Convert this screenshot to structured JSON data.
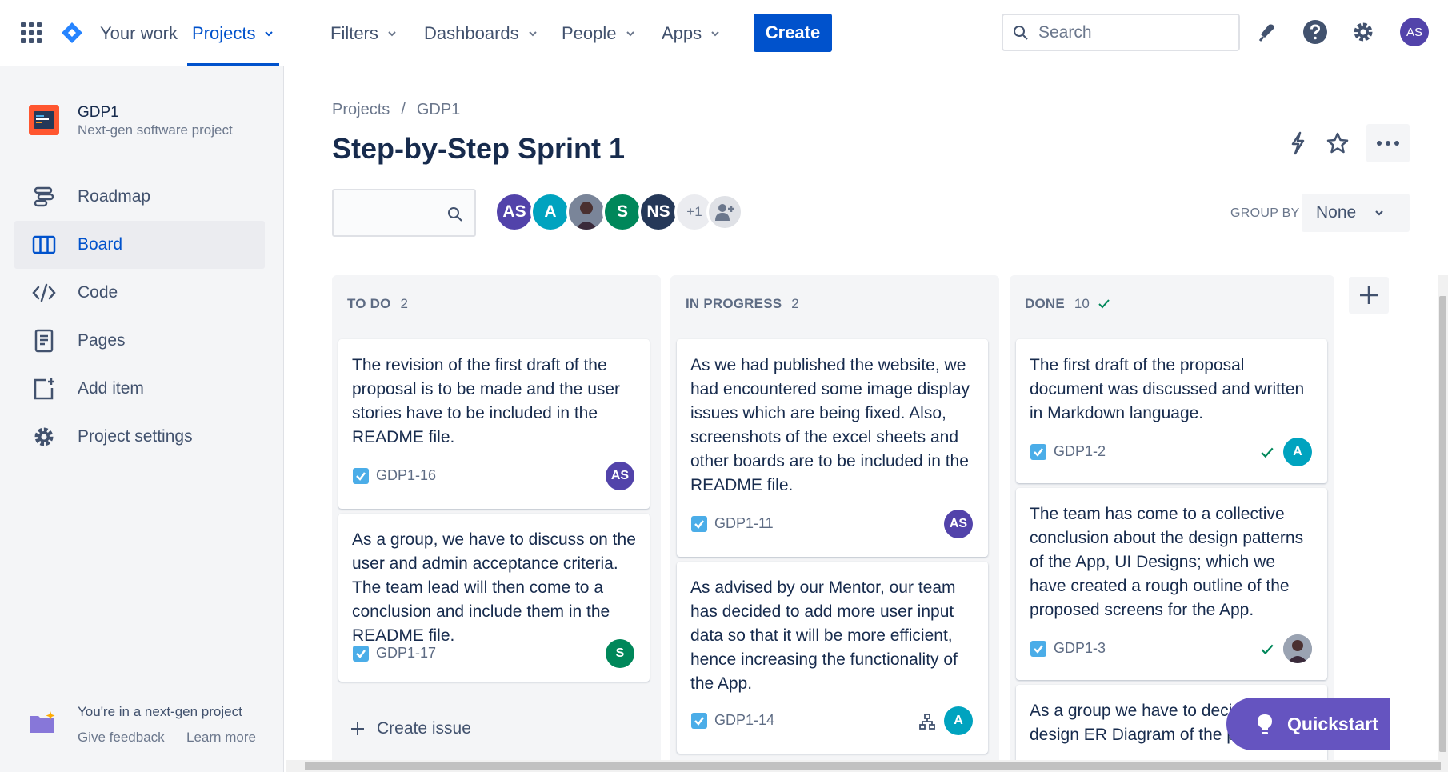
{
  "topnav": {
    "items": [
      {
        "label": "Your work"
      },
      {
        "label": "Projects"
      },
      {
        "label": "Filters"
      },
      {
        "label": "Dashboards"
      },
      {
        "label": "People"
      },
      {
        "label": "Apps"
      }
    ],
    "create_label": "Create",
    "search_placeholder": "Search",
    "user_initials": "AS",
    "accent": "#0052cc"
  },
  "sidebar": {
    "project_name": "GDP1",
    "project_type": "Next-gen software project",
    "items": [
      {
        "label": "Roadmap",
        "icon": "roadmap-icon"
      },
      {
        "label": "Board",
        "icon": "board-icon"
      },
      {
        "label": "Code",
        "icon": "code-icon"
      },
      {
        "label": "Pages",
        "icon": "pages-icon"
      },
      {
        "label": "Add item",
        "icon": "add-item-icon"
      },
      {
        "label": "Project settings",
        "icon": "gear-icon"
      }
    ],
    "footer_text": "You're in a next-gen project",
    "give_feedback": "Give feedback",
    "learn_more": "Learn more"
  },
  "header": {
    "breadcrumb": [
      "Projects",
      "GDP1"
    ],
    "breadcrumb_sep": "/",
    "title": "Step-by-Step Sprint 1",
    "members": [
      {
        "initials": "AS",
        "color": "#5243aa"
      },
      {
        "initials": "A",
        "color": "#00a3bf"
      },
      {
        "initials": "",
        "color": "#8993a4"
      },
      {
        "initials": "S",
        "color": "#00875a"
      },
      {
        "initials": "NS",
        "color": "#253858"
      }
    ],
    "extra_members": "+1",
    "group_by_label": "GROUP BY",
    "group_by_value": "None"
  },
  "columns": [
    {
      "name": "TO DO",
      "count": "2",
      "cards": [
        {
          "summary": "The revision of the first draft of the proposal is to be made and the user stories have to be included in the README file.",
          "key": "GDP1-16",
          "assignee": "AS",
          "color": "#5243aa"
        },
        {
          "summary": "As a group, we have to discuss on the user and admin acceptance criteria. The team lead will then come to a conclusion and include them in the README file.",
          "key": "GDP1-17",
          "assignee": "S",
          "color": "#00875a"
        }
      ],
      "create_issue": "Create issue"
    },
    {
      "name": "IN PROGRESS",
      "count": "2",
      "cards": [
        {
          "summary": "As we had published the website, we had encountered some image display issues which are being fixed. Also, screenshots of the excel sheets and other boards are to be included in the README file.",
          "key": "GDP1-11",
          "assignee": "AS",
          "color": "#5243aa"
        },
        {
          "summary": "As advised by our Mentor, our team has decided to add more user input data so that it will be more efficient, hence increasing the functionality of the App.",
          "key": "GDP1-14",
          "assignee": "A",
          "color": "#00a3bf"
        }
      ]
    },
    {
      "name": "DONE",
      "count": "10",
      "cards": [
        {
          "summary": "The first draft of the proposal document was discussed and written in Markdown language.",
          "key": "GDP1-2",
          "assignee": "A",
          "color": "#00a3bf"
        },
        {
          "summary": "The team has come to a collective conclusion about the design patterns of the App, UI Designs; which we have created a rough outline of the proposed screens for the App.",
          "key": "GDP1-3",
          "assignee": "",
          "color": "#8993a4"
        },
        {
          "summary": "As a group we have to decide and design ER Diagram of the p... App",
          "key": "",
          "assignee": "",
          "color": "#ffffff"
        }
      ]
    }
  ],
  "quickstart_label": "Quickstart"
}
